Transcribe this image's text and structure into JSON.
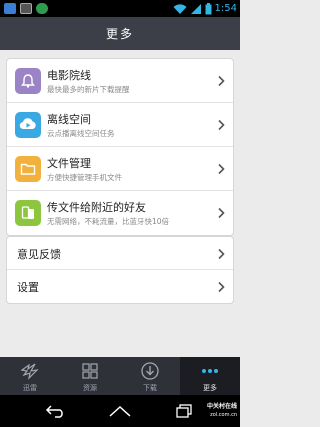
{
  "status_bar": {
    "time": "1:54",
    "icons": [
      "app-notification-icon",
      "image-notification-icon",
      "shield-notification-icon",
      "wifi-icon",
      "signal-icon",
      "battery-icon"
    ]
  },
  "header": {
    "title": "更多"
  },
  "menu": {
    "features": [
      {
        "title": "电影院线",
        "subtitle": "最快最多的新片下载提醒",
        "icon": "bell-icon",
        "color": "#9b84c6"
      },
      {
        "title": "离线空间",
        "subtitle": "云点播离线空间任务",
        "icon": "cloud-play-icon",
        "color": "#3aa8e2"
      },
      {
        "title": "文件管理",
        "subtitle": "方便快捷管理手机文件",
        "icon": "folder-icon",
        "color": "#f2b13c"
      },
      {
        "title": "传文件给附近的好友",
        "subtitle": "无需网络，不耗流量，比蓝牙快10倍",
        "icon": "phone-share-icon",
        "color": "#8cc63f"
      }
    ],
    "settings": [
      {
        "label": "意见反馈"
      },
      {
        "label": "设置"
      }
    ]
  },
  "tabs": [
    {
      "label": "迅雷",
      "icon": "thunder-bird-icon",
      "active": false
    },
    {
      "label": "资源",
      "icon": "grid-icon",
      "active": false
    },
    {
      "label": "下载",
      "icon": "download-icon",
      "active": false
    },
    {
      "label": "更多",
      "icon": "more-dots-icon",
      "active": true
    }
  ],
  "nav": {
    "buttons": [
      "back-icon",
      "home-icon",
      "recent-apps-icon"
    ]
  },
  "watermark": {
    "line1": "中关村在线",
    "line2": "zol.com.cn"
  },
  "colors": {
    "title_bar": "#3c3f48",
    "tab_bar": "#2f3139",
    "tab_active": "#1c1d22",
    "background": "#ebebeb",
    "time": "#33b5e5"
  }
}
